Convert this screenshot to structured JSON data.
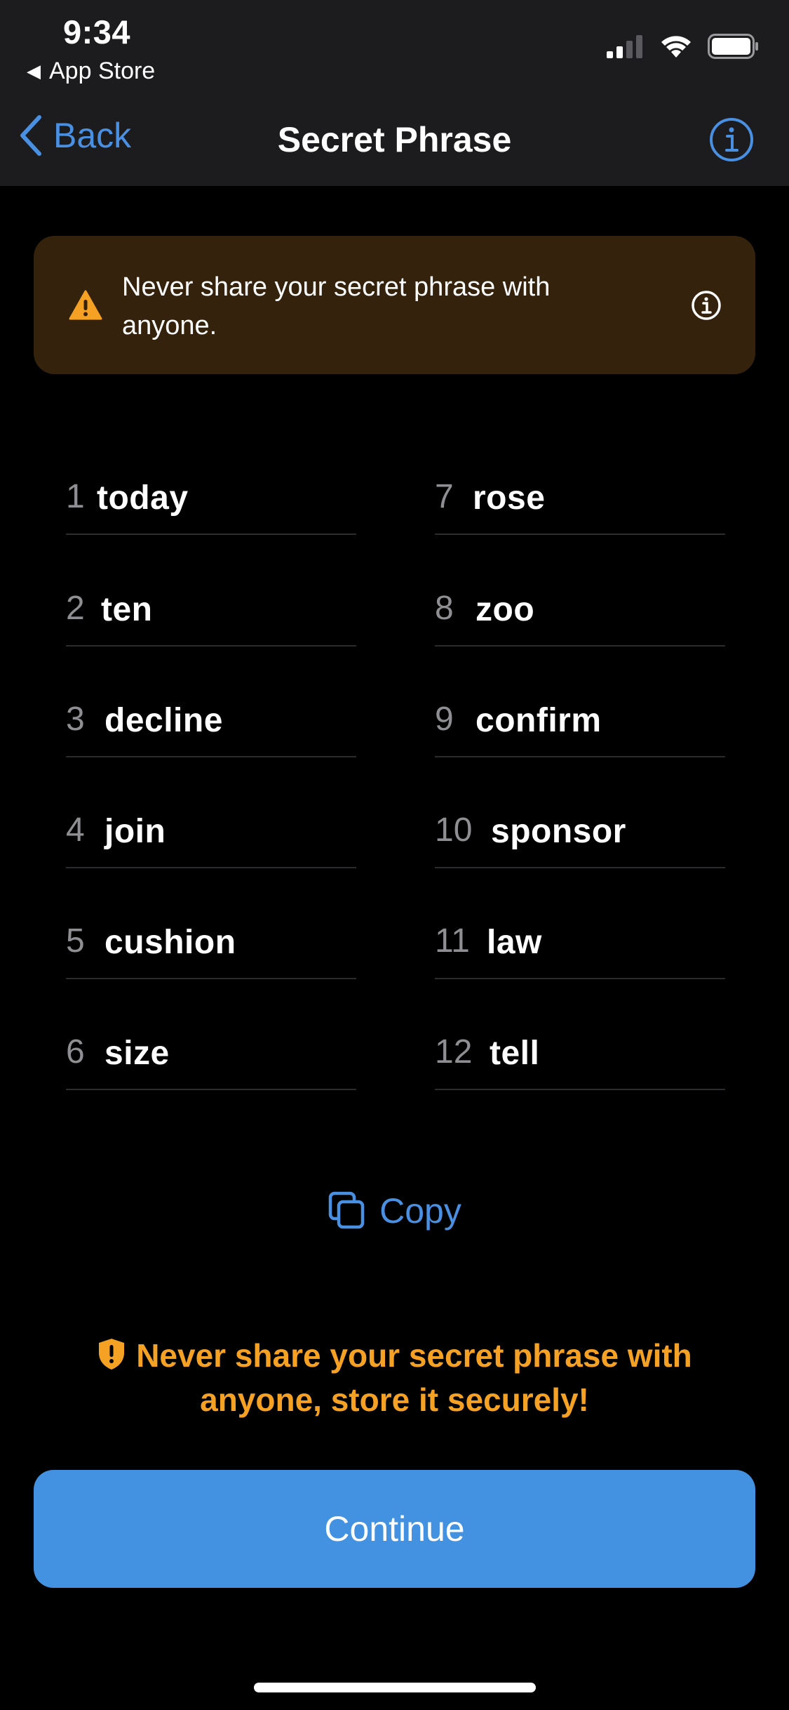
{
  "status_bar": {
    "time": "9:34",
    "back_app_label": "App Store",
    "icons": [
      "signal-icon",
      "wifi-icon",
      "battery-icon"
    ]
  },
  "nav": {
    "back_label": "Back",
    "title": "Secret Phrase",
    "info_icon": "info-icon"
  },
  "banner": {
    "text": "Never share your secret phrase with anyone.",
    "icon": "warning-icon",
    "info_icon": "info-icon"
  },
  "words": [
    {
      "index": "1",
      "word": "today"
    },
    {
      "index": "2",
      "word": "ten"
    },
    {
      "index": "3",
      "word": "decline"
    },
    {
      "index": "4",
      "word": "join"
    },
    {
      "index": "5",
      "word": "cushion"
    },
    {
      "index": "6",
      "word": "size"
    },
    {
      "index": "7",
      "word": "rose"
    },
    {
      "index": "8",
      "word": "zoo"
    },
    {
      "index": "9",
      "word": "confirm"
    },
    {
      "index": "10",
      "word": "sponsor"
    },
    {
      "index": "11",
      "word": "law"
    },
    {
      "index": "12",
      "word": "tell"
    }
  ],
  "copy": {
    "label": "Copy",
    "icon": "copy-icon"
  },
  "bottom_warning": {
    "text": "Never share your secret phrase with anyone, store it securely!",
    "icon": "shield-icon"
  },
  "continue": {
    "label": "Continue"
  },
  "colors": {
    "accent": "#4a90e2",
    "button": "#4391e1",
    "warning": "#f5a124",
    "banner_bg": "#35220c",
    "chrome_bg": "#1c1c1e"
  }
}
